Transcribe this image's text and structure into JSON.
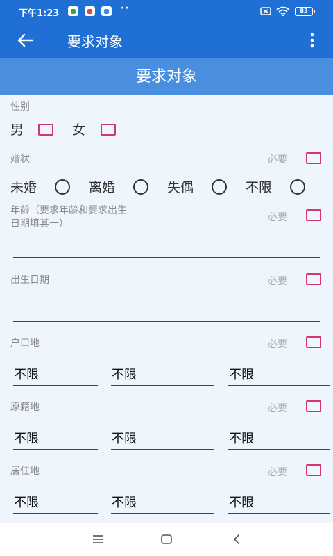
{
  "status": {
    "time": "下午1:23",
    "more_dots": "··",
    "battery": "83"
  },
  "appbar": {
    "title": "要求对象",
    "back_icon": "arrow-left-icon",
    "menu_icon": "more-vertical-icon"
  },
  "section_header": "要求对象",
  "form": {
    "gender": {
      "label": "性别",
      "options": [
        "男",
        "女"
      ]
    },
    "marital": {
      "label": "婚状",
      "required": "必要",
      "options": [
        "未婚",
        "离婚",
        "失偶",
        "不限"
      ]
    },
    "age": {
      "label_line1": "年龄（要求年龄和要求出生",
      "label_line2": "日期填其一）",
      "required": "必要",
      "value": ""
    },
    "birth_date": {
      "label": "出生日期",
      "required": "必要",
      "value": ""
    },
    "hukou": {
      "label": "户口地",
      "required": "必要",
      "values": [
        "不限",
        "不限",
        "不限"
      ]
    },
    "native": {
      "label": "原籍地",
      "required": "必要",
      "values": [
        "不限",
        "不限",
        "不限"
      ]
    },
    "residence": {
      "label": "居住地",
      "required": "必要",
      "values": [
        "不限",
        "不限",
        "不限"
      ]
    }
  },
  "colors": {
    "primary": "#1f6fd4",
    "header": "#4a8fdf",
    "background": "#eef5fd",
    "checkbox": "#d43770"
  }
}
